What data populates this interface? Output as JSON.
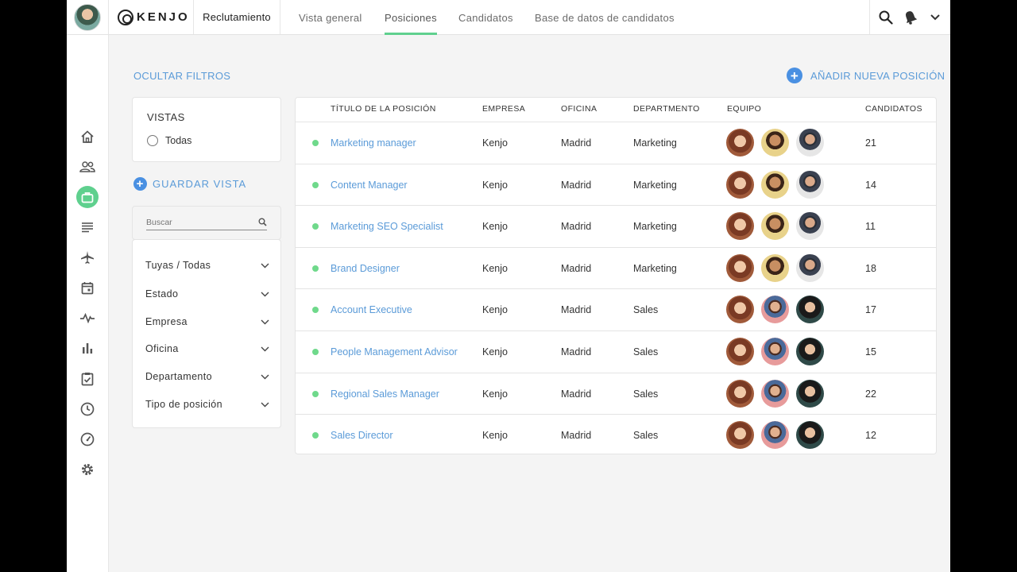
{
  "topbar": {
    "brand": "KENJO",
    "module": "Reclutamiento",
    "tabs": [
      {
        "label": "Vista general",
        "active": false
      },
      {
        "label": "Posiciones",
        "active": true
      },
      {
        "label": "Candidatos",
        "active": false
      },
      {
        "label": "Base de datos de candidatos",
        "active": false
      }
    ],
    "icons": [
      "search-icon",
      "bell-icon",
      "chevron-down-icon"
    ]
  },
  "sidebar": {
    "items": [
      "home-icon",
      "people-icon",
      "briefcase-icon",
      "list-icon",
      "airplane-icon",
      "calendar-icon",
      "pulse-icon",
      "bar-chart-icon",
      "checklist-icon",
      "clock-icon",
      "gauge-icon",
      "gear-icon"
    ],
    "active": "briefcase-icon"
  },
  "actions": {
    "hide_filters": "OCULTAR FILTROS",
    "add_position": "AÑADIR NUEVA POSICIÓN",
    "save_view": "GUARDAR VISTA"
  },
  "views": {
    "title": "VISTAS",
    "option": "Todas"
  },
  "search": {
    "placeholder": "Buscar"
  },
  "filters": [
    "Tuyas / Todas",
    "Estado",
    "Empresa",
    "Oficina",
    "Departamento",
    "Tipo de posición"
  ],
  "table": {
    "headers": {
      "title": "TÍTULO DE LA POSICIÓN",
      "company": "EMPRESA",
      "office": "OFICINA",
      "department": "DEPARTMENTO",
      "team": "EQUIPO",
      "candidates": "CANDIDATOS"
    },
    "rows": [
      {
        "title": "Marketing manager",
        "company": "Kenjo",
        "office": "Madrid",
        "department": "Marketing",
        "candidates": "21",
        "team": [
          "f1",
          "f2",
          "f3"
        ]
      },
      {
        "title": "Content Manager",
        "company": "Kenjo",
        "office": "Madrid",
        "department": "Marketing",
        "candidates": "14",
        "team": [
          "f1",
          "f2",
          "f3"
        ]
      },
      {
        "title": "Marketing SEO Specialist",
        "company": "Kenjo",
        "office": "Madrid",
        "department": "Marketing",
        "candidates": "11",
        "team": [
          "f1",
          "f2",
          "f3"
        ]
      },
      {
        "title": "Brand Designer",
        "company": "Kenjo",
        "office": "Madrid",
        "department": "Marketing",
        "candidates": "18",
        "team": [
          "f1",
          "f2",
          "f3"
        ]
      },
      {
        "title": "Account Executive",
        "company": "Kenjo",
        "office": "Madrid",
        "department": "Sales",
        "candidates": "17",
        "team": [
          "f1",
          "f4",
          "f5"
        ]
      },
      {
        "title": "People Management Advisor",
        "company": "Kenjo",
        "office": "Madrid",
        "department": "Sales",
        "candidates": "15",
        "team": [
          "f1",
          "f4",
          "f5"
        ]
      },
      {
        "title": "Regional Sales Manager",
        "company": "Kenjo",
        "office": "Madrid",
        "department": "Sales",
        "candidates": "22",
        "team": [
          "f1",
          "f4",
          "f5"
        ]
      },
      {
        "title": "Sales Director",
        "company": "Kenjo",
        "office": "Madrid",
        "department": "Sales",
        "candidates": "12",
        "team": [
          "f1",
          "f4",
          "f5"
        ]
      }
    ]
  },
  "colors": {
    "accent_green": "#5fd08e",
    "link_blue": "#5b9bd8",
    "button_blue": "#4a90e2",
    "status_dot": "#6fd98b"
  }
}
